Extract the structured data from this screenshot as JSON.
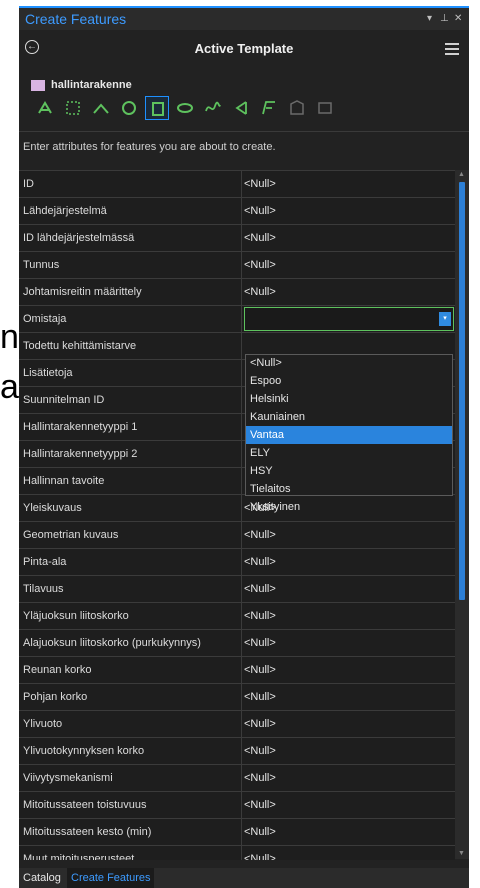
{
  "window": {
    "title": "Create Features",
    "pin_icon": "pin-icon",
    "close_icon": "close-icon",
    "menu_arrow": "▾",
    "pin_glyph": "⊥",
    "close_glyph": "✕"
  },
  "header": {
    "title": "Active Template",
    "back_icon": "back-arrow-icon",
    "menu_icon": "hamburger-menu-icon"
  },
  "template": {
    "name": "hallintarakenne",
    "swatch_color": "#d8b4e2"
  },
  "tools": [
    {
      "name": "trace-tool-icon",
      "active": false
    },
    {
      "name": "rectangle-select-tool-icon",
      "active": false
    },
    {
      "name": "line-tool-icon",
      "active": false
    },
    {
      "name": "circle-tool-icon",
      "active": false
    },
    {
      "name": "rectangle-tool-icon",
      "active": true
    },
    {
      "name": "ellipse-tool-icon",
      "active": false
    },
    {
      "name": "freehand-tool-icon",
      "active": false
    },
    {
      "name": "autocomplete-polygon-tool-icon",
      "active": false
    },
    {
      "name": "right-angle-tool-icon",
      "active": false
    },
    {
      "name": "building-tool-icon",
      "active": false
    },
    {
      "name": "footprint-tool-icon",
      "active": false
    }
  ],
  "instructions": "Enter attributes for features you are about to create.",
  "attributes": [
    {
      "label": "ID",
      "value": "<Null>"
    },
    {
      "label": "Lähdejärjestelmä",
      "value": "<Null>"
    },
    {
      "label": "ID lähdejärjestelmässä",
      "value": "<Null>"
    },
    {
      "label": "Tunnus",
      "value": "<Null>"
    },
    {
      "label": "Johtamisreitin määrittely",
      "value": "<Null>"
    },
    {
      "label": "Omistaja",
      "value": "",
      "editing": true
    },
    {
      "label": "Todettu kehittämistarve",
      "value": ""
    },
    {
      "label": "Lisätietoja",
      "value": ""
    },
    {
      "label": "Suunnitelman ID",
      "value": ""
    },
    {
      "label": "Hallintarakennetyyppi 1",
      "value": ""
    },
    {
      "label": "Hallintarakennetyyppi 2",
      "value": ""
    },
    {
      "label": "Hallinnan tavoite",
      "value": ""
    },
    {
      "label": "Yleiskuvaus",
      "value": "<Null>"
    },
    {
      "label": "Geometrian kuvaus",
      "value": "<Null>"
    },
    {
      "label": "Pinta-ala",
      "value": "<Null>"
    },
    {
      "label": "Tilavuus",
      "value": "<Null>"
    },
    {
      "label": "Yläjuoksun liitoskorko",
      "value": "<Null>"
    },
    {
      "label": "Alajuoksun liitoskorko (purkukynnys)",
      "value": "<Null>"
    },
    {
      "label": "Reunan korko",
      "value": "<Null>"
    },
    {
      "label": "Pohjan korko",
      "value": "<Null>"
    },
    {
      "label": "Ylivuoto",
      "value": "<Null>"
    },
    {
      "label": "Ylivuotokynnyksen korko",
      "value": "<Null>"
    },
    {
      "label": "Viivytysmekanismi",
      "value": "<Null>"
    },
    {
      "label": "Mitoitussateen toistuvuus",
      "value": "<Null>"
    },
    {
      "label": "Mitoitussateen kesto (min)",
      "value": "<Null>"
    },
    {
      "label": "Muut mitoitusperusteet",
      "value": "<Null>"
    }
  ],
  "dropdown": {
    "options": [
      "<Null>",
      "Espoo",
      "Helsinki",
      "Kauniainen",
      "Vantaa",
      "ELY",
      "HSY",
      "Tielaitos",
      "Yksityinen"
    ],
    "selected": "Vantaa",
    "arrow": "▾"
  },
  "scrollbar": {
    "up": "▲",
    "down": "▼"
  },
  "bottom_tabs": [
    {
      "label": "Catalog",
      "active": false
    },
    {
      "label": "Create Features",
      "active": true
    }
  ],
  "background": {
    "letter1": "n",
    "letter2": "a"
  },
  "colors": {
    "accent": "#1e90ff",
    "selection": "#2a84dd",
    "edit_border": "#5ec25e",
    "panel_bg": "#222222"
  }
}
